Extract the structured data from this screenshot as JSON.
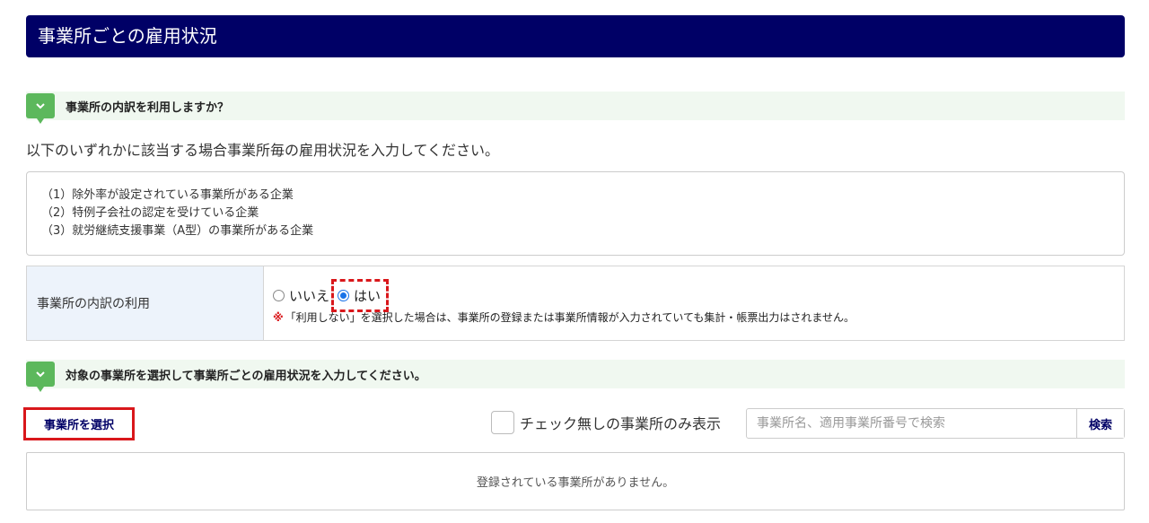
{
  "header": {
    "title": "事業所ごとの雇用状況"
  },
  "section1": {
    "title": "事業所の内訳を利用しますか？"
  },
  "intro": "以下のいずれかに該当する場合事業所毎の雇用状況を入力してください。",
  "criteria": [
    "（1）除外率が設定されている事業所がある企業",
    "（2）特例子会社の認定を受けている企業",
    "（3）就労継続支援事業（A型）の事業所がある企業"
  ],
  "usage": {
    "label": "事業所の内訳の利用",
    "options": [
      {
        "label": "いいえ",
        "checked": false
      },
      {
        "label": "はい",
        "checked": true
      }
    ],
    "note_mark": "※",
    "note": "「利用しない」を選択した場合は、事業所の登録または事業所情報が入力されていても集計・帳票出力はされません。"
  },
  "section2": {
    "title": "対象の事業所を選択して事業所ごとの雇用状況を入力してください。"
  },
  "toolbar": {
    "select_button": "事業所を選択",
    "filter_label": "チェック無しの事業所のみ表示",
    "search_placeholder": "事業所名、適用事業所番号で検索",
    "search_button": "検索"
  },
  "empty_message": "登録されている事業所がありません。",
  "colors": {
    "header_bg": "#000066",
    "accent_green": "#5cb85c",
    "highlight_red": "#d9171b",
    "radio_blue": "#1a73e8"
  }
}
